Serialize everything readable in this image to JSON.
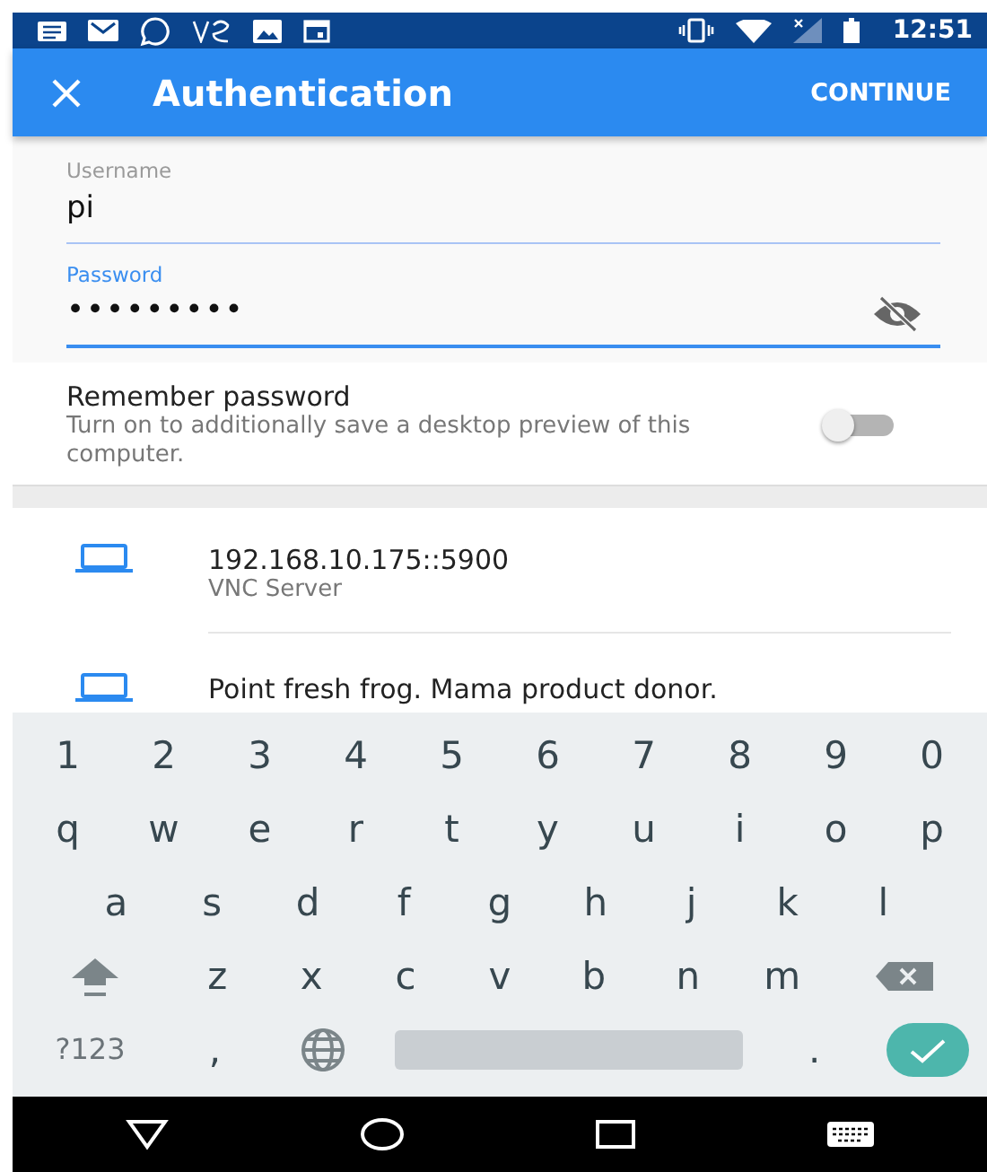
{
  "status_bar": {
    "time": "12:51"
  },
  "app_bar": {
    "title": "Authentication",
    "action": "CONTINUE"
  },
  "fields": [
    {
      "label": "Username",
      "value": "pi",
      "focused": false,
      "kind": "text"
    },
    {
      "label": "Password",
      "value": "•••••••••",
      "focused": true,
      "kind": "password"
    }
  ],
  "remember": {
    "title": "Remember password",
    "description": "Turn on to additionally save a desktop preview of this computer.",
    "on": false
  },
  "servers": [
    {
      "address": "192.168.10.175::5900",
      "subtitle": "VNC Server"
    },
    {
      "address": "Point fresh frog. Mama product donor."
    }
  ],
  "keyboard": {
    "rows": [
      [
        {
          "kind": "char",
          "label": "1"
        },
        {
          "kind": "char",
          "label": "2"
        },
        {
          "kind": "char",
          "label": "3"
        },
        {
          "kind": "char",
          "label": "4"
        },
        {
          "kind": "char",
          "label": "5"
        },
        {
          "kind": "char",
          "label": "6"
        },
        {
          "kind": "char",
          "label": "7"
        },
        {
          "kind": "char",
          "label": "8"
        },
        {
          "kind": "char",
          "label": "9"
        },
        {
          "kind": "char",
          "label": "0"
        }
      ],
      [
        {
          "kind": "char",
          "label": "q"
        },
        {
          "kind": "char",
          "label": "w"
        },
        {
          "kind": "char",
          "label": "e"
        },
        {
          "kind": "char",
          "label": "r"
        },
        {
          "kind": "char",
          "label": "t"
        },
        {
          "kind": "char",
          "label": "y"
        },
        {
          "kind": "char",
          "label": "u"
        },
        {
          "kind": "char",
          "label": "i"
        },
        {
          "kind": "char",
          "label": "o"
        },
        {
          "kind": "char",
          "label": "p"
        }
      ],
      [
        {
          "kind": "char",
          "label": "a"
        },
        {
          "kind": "char",
          "label": "s"
        },
        {
          "kind": "char",
          "label": "d"
        },
        {
          "kind": "char",
          "label": "f"
        },
        {
          "kind": "char",
          "label": "g"
        },
        {
          "kind": "char",
          "label": "h"
        },
        {
          "kind": "char",
          "label": "j"
        },
        {
          "kind": "char",
          "label": "k"
        },
        {
          "kind": "char",
          "label": "l"
        }
      ],
      [
        {
          "kind": "shift"
        },
        {
          "kind": "char",
          "label": "z"
        },
        {
          "kind": "char",
          "label": "x"
        },
        {
          "kind": "char",
          "label": "c"
        },
        {
          "kind": "char",
          "label": "v"
        },
        {
          "kind": "char",
          "label": "b"
        },
        {
          "kind": "char",
          "label": "n"
        },
        {
          "kind": "char",
          "label": "m"
        },
        {
          "kind": "backspace"
        }
      ],
      [
        {
          "kind": "mode",
          "label": "?123"
        },
        {
          "kind": "char",
          "label": ","
        },
        {
          "kind": "globe"
        },
        {
          "kind": "space"
        },
        {
          "kind": "char",
          "label": "."
        },
        {
          "kind": "enter"
        }
      ]
    ]
  }
}
